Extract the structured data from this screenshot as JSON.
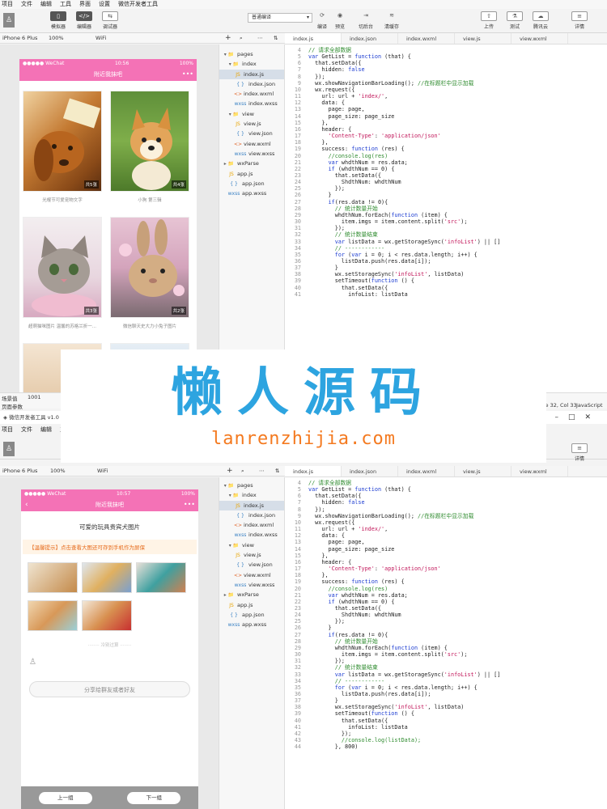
{
  "app": {
    "window_title": "微信开发者工具 v1.0"
  },
  "menu": [
    "项目",
    "文件",
    "编辑",
    "工具",
    "界面",
    "设置",
    "微信开发者工具"
  ],
  "toolbar": {
    "simulator": "模拟器",
    "editor": "编辑器",
    "debugger": "调试器",
    "compile_mode": "普通编译",
    "compile": "编译",
    "preview": "预览",
    "backend": "切后台",
    "clear_cache": "清缓存",
    "upload": "上传",
    "test": "测试",
    "tencent_cloud": "腾讯云",
    "details": "详情"
  },
  "device": {
    "model": "iPhone 6 Plus",
    "zoom": "100%",
    "network": "WiFi"
  },
  "phone1": {
    "carrier": "●●●●● WeChat",
    "time": "10:56",
    "battery": "100%",
    "title": "附近我抹吧",
    "more": "•••",
    "cards": [
      {
        "count": "共5张",
        "caption": "光棍节可爱宠物文字"
      },
      {
        "count": "共4张",
        "caption": "小狗 第三辑"
      },
      {
        "count": "共3张",
        "caption": "超萌猫咪图片 温馨的苏格兰折一..."
      },
      {
        "count": "共2张",
        "caption": "微信聊天史大力小兔子图片"
      }
    ]
  },
  "phone2": {
    "carrier": "●●●●● WeChat",
    "time": "10:57",
    "battery": "100%",
    "back": "‹",
    "title": "附近我抹吧",
    "more": "•••",
    "page_title": "可爱的玩具贵宾犬图片",
    "tip": "【温馨提示】点击查看大图还可存到手机作为屏保",
    "separator": "········ 冷别过算 ········",
    "share": "分享给群友或者好友",
    "prev": "上一组",
    "next": "下一组"
  },
  "filetree": {
    "items": [
      {
        "label": "pages",
        "icon": "▾ 📁"
      },
      {
        "label": "index",
        "icon": "▾ 📁"
      },
      {
        "label": "index.js",
        "icon": "JS"
      },
      {
        "label": "index.json",
        "icon": "{ }"
      },
      {
        "label": "index.wxml",
        "icon": "<>"
      },
      {
        "label": "index.wxss",
        "icon": "wxss"
      },
      {
        "label": "view",
        "icon": "▾ 📁"
      },
      {
        "label": "view.js",
        "icon": "JS"
      },
      {
        "label": "view.json",
        "icon": "{ }"
      },
      {
        "label": "view.wxml",
        "icon": "<>"
      },
      {
        "label": "view.wxss",
        "icon": "wxss"
      },
      {
        "label": "wxParse",
        "icon": "▸ 📁"
      },
      {
        "label": "app.js",
        "icon": "JS"
      },
      {
        "label": "app.json",
        "icon": "{ }"
      },
      {
        "label": "app.wxss",
        "icon": "wxss"
      }
    ]
  },
  "tabs": [
    "index.js",
    "index.json",
    "index.wxml",
    "view.js",
    "view.wxml"
  ],
  "code1": [
    "// 请求全部数据",
    "var GetList = function (that) {",
    "  that.setData({",
    "    hidden: false",
    "  });",
    "  wx.showNavigationBarLoading(); //在标题栏中显示加载",
    "  wx.request({",
    "    url: url + 'index/',",
    "    data: {",
    "      page: page,",
    "      page_size: page_size",
    "    },",
    "    header: {",
    "      'Content-Type': 'application/json'",
    "    },",
    "    success: function (res) {",
    "      //console.log(res)",
    "      var whdthNum = res.data;",
    "      if (whdthNum == 0) {",
    "        that.setData({",
    "          ShdthNum: whdthNum",
    "        });",
    "      }",
    "      if(res.data != 0){",
    "        // 统计数量开始",
    "        whdthNum.forEach(function (item) {",
    "          item.imgs = item.content.split('src');",
    "        });",
    "        // 统计数量结束",
    "        var listData = wx.getStorageSync('infoList') || []",
    "        // ------------",
    "        for (var i = 0; i < res.data.length; i++) {",
    "          listData.push(res.data[i]);",
    "        }",
    "        wx.setStorageSync('infoList', listData)",
    "        setTimeout(function () {",
    "          that.setData({",
    "            infoList: listData",
    "          });",
    "          //console.log(listData);",
    "        }, 800)",
    "        page++;"
  ],
  "code_start_line": 4,
  "statusbar1": {
    "scene_label": "场景值",
    "scene_value": "1001",
    "page_params": "页面参数",
    "cursor": "Line 32, Col 33",
    "lang": "JavaScript"
  },
  "watermark": {
    "cn": "懒人源码",
    "en": "lanrenzhijia.com"
  }
}
